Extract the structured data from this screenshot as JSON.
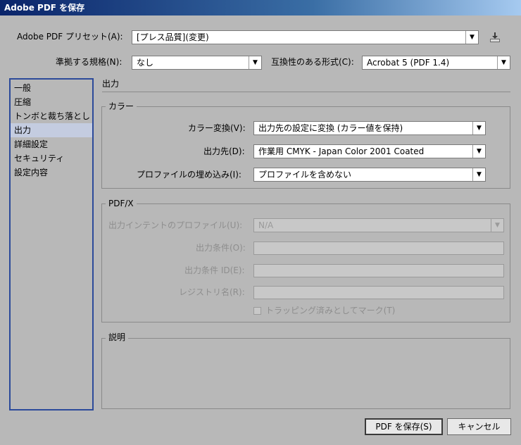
{
  "window": {
    "title": "Adobe PDF を保存"
  },
  "preset": {
    "label": "Adobe PDF プリセット(A):",
    "value": "[プレス品質](変更)"
  },
  "standard": {
    "label": "準拠する規格(N):",
    "value": "なし"
  },
  "compatibility": {
    "label": "互換性のある形式(C):",
    "value": "Acrobat 5 (PDF 1.4)"
  },
  "sidebar": {
    "items": [
      {
        "label": "一般"
      },
      {
        "label": "圧縮"
      },
      {
        "label": "トンボと裁ち落とし"
      },
      {
        "label": "出力"
      },
      {
        "label": "詳細設定"
      },
      {
        "label": "セキュリティ"
      },
      {
        "label": "設定内容"
      }
    ]
  },
  "section_title": "出力",
  "color_group": {
    "title": "カラー",
    "conversion_label": "カラー変換(V):",
    "conversion_value": "出力先の設定に変換 (カラー値を保持)",
    "destination_label": "出力先(D):",
    "destination_value": "作業用 CMYK - Japan Color 2001 Coated",
    "profile_label": "プロファイルの埋め込み(I):",
    "profile_value": "プロファイルを含めない"
  },
  "pdfx_group": {
    "title": "PDF/X",
    "intent_label": "出力インテントのプロファイル(U):",
    "intent_value": "N/A",
    "condition_label": "出力条件(O):",
    "condition_id_label": "出力条件 ID(E):",
    "registry_label": "レジストリ名(R):",
    "trapped_label": "トラッピング済みとしてマーク(T)"
  },
  "description_group": {
    "title": "説明"
  },
  "buttons": {
    "save": "PDF を保存(S)",
    "cancel": "キャンセル"
  }
}
